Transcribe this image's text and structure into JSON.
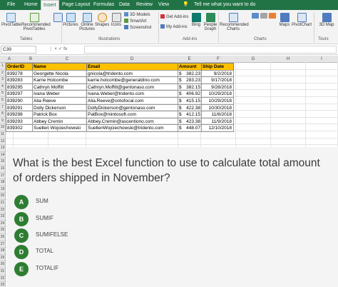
{
  "ribbon": {
    "tabs": [
      "File",
      "Home",
      "Insert",
      "Page Layout",
      "Formulas",
      "Data",
      "Review",
      "View"
    ],
    "active_tab": "Insert",
    "tell_me": "Tell me what you want to do",
    "buttons": {
      "pivottable": "PivotTable",
      "recommended_pivottables": "Recommended PivotTables",
      "pictures": "Pictures",
      "online_pictures": "Online Pictures",
      "shapes": "Shapes",
      "icons": "Icons",
      "models_3d": "3D Models",
      "smartart": "SmartArt",
      "screenshot": "Screenshot",
      "get_addins": "Get Add-ins",
      "my_addins": "My Add-ins",
      "bing": "Bing",
      "people_graph": "People Graph",
      "recommended_charts": "Recommended Charts",
      "maps": "Maps",
      "pivotchart": "PivotChart",
      "3d_map": "3D Map"
    },
    "groups": {
      "tables": "Tables",
      "illustrations": "Illustrations",
      "addins": "Add-ins",
      "charts": "Charts",
      "tours": "Tours"
    }
  },
  "formula_bar": {
    "name_box": "C39",
    "fx_symbols": "⋮   ×   ✓   fx",
    "value": ""
  },
  "sheet": {
    "columns": [
      "A",
      "B",
      "C",
      "D",
      "E",
      "F",
      "G",
      "H",
      "I"
    ],
    "rows": [
      "1",
      "2",
      "3",
      "4",
      "5",
      "6",
      "7",
      "8",
      "9",
      "10",
      "11",
      "12",
      "13",
      "14",
      "15",
      "16",
      "17",
      "18",
      "19",
      "20",
      "21",
      "22",
      "23",
      "24",
      "25",
      "26",
      "27",
      "28",
      "29",
      "30",
      "31",
      "32",
      "33"
    ],
    "headers": [
      "OrderID",
      "Name",
      "Email",
      "Amount",
      "Ship Date"
    ],
    "data": [
      {
        "id": "839278",
        "name": "Georgette Nicola",
        "email": "gnicola@tridento.com",
        "cur": "$",
        "amount": "382.23",
        "date": "9/2/2018"
      },
      {
        "id": "839283",
        "name": "Karrie Holcombe",
        "email": "karrie.holcombe@generaldino.com",
        "cur": "$",
        "amount": "283.23",
        "date": "9/17/2018"
      },
      {
        "id": "839295",
        "name": "Cathryn Moffitt",
        "email": "Cathryn.Moffitt@gentonaso.com",
        "cur": "$",
        "amount": "382.15",
        "date": "9/28/2018"
      },
      {
        "id": "839297",
        "name": "Ivana Weber",
        "email": "Ivana.Weber@tridento.com",
        "cur": "$",
        "amount": "406.92",
        "date": "10/29/2018"
      },
      {
        "id": "839290",
        "name": "Alia Reeve",
        "email": "Alia.Reeve@ontofocal.com",
        "cur": "$",
        "amount": "415.15",
        "date": "10/29/2018"
      },
      {
        "id": "839291",
        "name": "Dolly Dickerson",
        "email": "DollyDickerson@gentonaso.com",
        "cur": "$",
        "amount": "422.38",
        "date": "10/30/2018"
      },
      {
        "id": "839298",
        "name": "Patrick Box",
        "email": "PatBox@mintosoft.com",
        "cur": "$",
        "amount": "412.15",
        "date": "11/8/2018"
      },
      {
        "id": "839293",
        "name": "Abbey Cremin",
        "email": "Abbey.Cremin@ascentiono.com",
        "cur": "$",
        "amount": "423.38",
        "date": "11/9/2018"
      },
      {
        "id": "839302",
        "name": "Suellen Wojciechowski",
        "email": "SuellenWojciechowski@tridento.com",
        "cur": "$",
        "amount": "448.07",
        "date": "12/10/2018"
      }
    ]
  },
  "quiz": {
    "question": "What is the best Excel function to use to calculate total amount of orders shipped in November?",
    "options": [
      {
        "letter": "A",
        "text": "SUM"
      },
      {
        "letter": "B",
        "text": "SUMIF"
      },
      {
        "letter": "C",
        "text": "SUMIFELSE"
      },
      {
        "letter": "D",
        "text": "TOTAL"
      },
      {
        "letter": "E",
        "text": "TOTALIF"
      }
    ]
  },
  "colors": {
    "excel_green": "#217346",
    "header_fill": "#ffc000",
    "badge_green": "#2e7d32"
  }
}
